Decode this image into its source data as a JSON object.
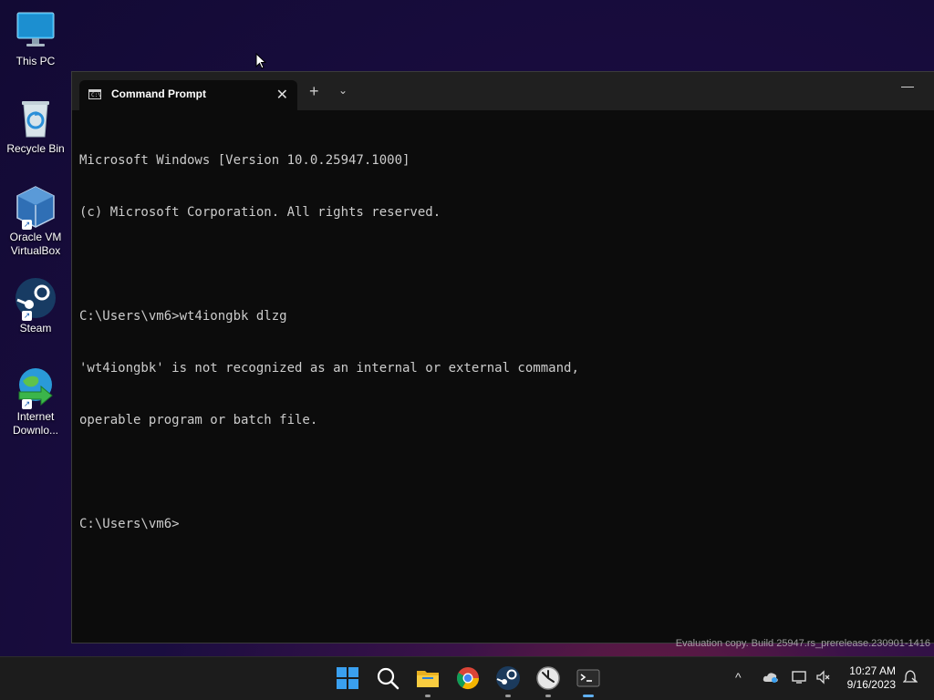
{
  "desktop": {
    "icons": [
      {
        "label": "This PC"
      },
      {
        "label": "Recycle Bin"
      },
      {
        "label": "Oracle VM VirtualBox"
      },
      {
        "label": "Steam"
      },
      {
        "label": "Internet Downlo..."
      }
    ]
  },
  "window": {
    "tab_title": "Command Prompt",
    "tab_close": "✕",
    "new_tab": "+",
    "dropdown": "⌄",
    "minimize": "—",
    "console_lines": [
      "Microsoft Windows [Version 10.0.25947.1000]",
      "(c) Microsoft Corporation. All rights reserved.",
      "",
      "C:\\Users\\vm6>wt4iongbk dlzg",
      "'wt4iongbk' is not recognized as an internal or external command,",
      "operable program or batch file.",
      "",
      "C:\\Users\\vm6>"
    ]
  },
  "watermark": "Evaluation copy. Build 25947.rs_prerelease.230901-1416",
  "taskbar": {
    "apps": [
      "start-icon",
      "search-icon",
      "file-explorer-icon",
      "chrome-icon",
      "steam-icon",
      "clock-app-icon",
      "terminal-icon"
    ],
    "tray_chevron": "^",
    "time": "10:27 AM",
    "date": "9/16/2023"
  }
}
